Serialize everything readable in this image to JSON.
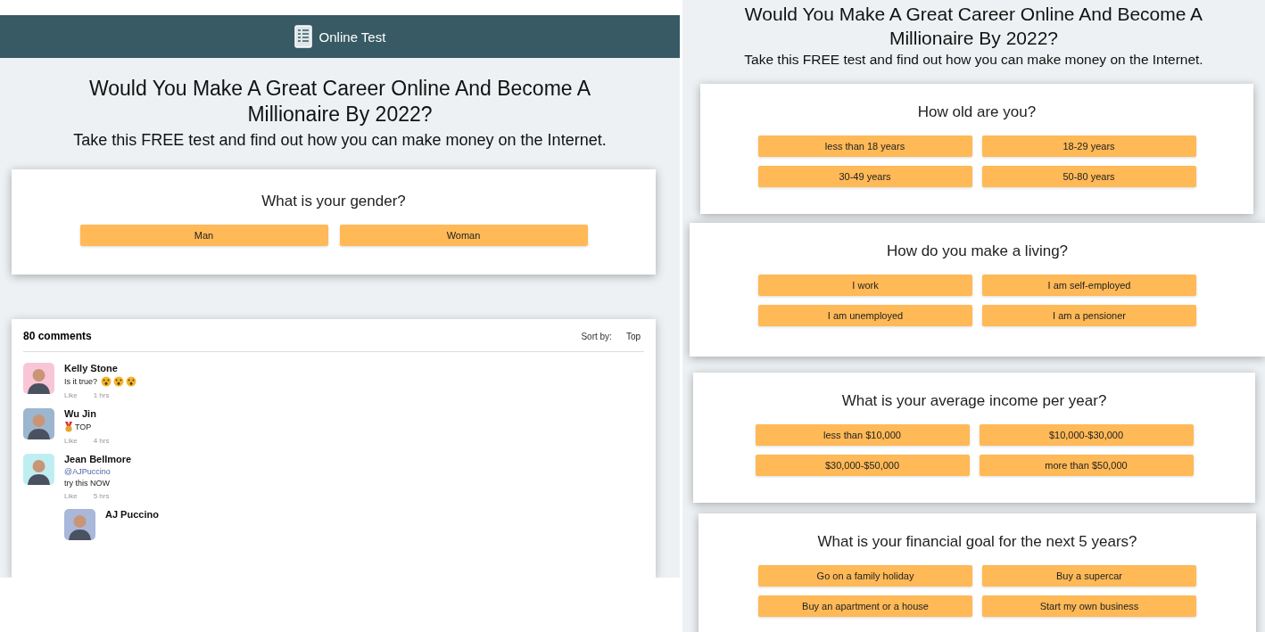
{
  "panels": [
    {
      "header": {
        "title": "Online Test"
      },
      "headline": "Would You Make A Great Career Online And Become A Millionaire By 2022?",
      "subline": "Take this FREE test and find out how you can make money on the Internet.",
      "questions": [
        {
          "question": "What is your gender?",
          "options": [
            "Man",
            "Woman"
          ]
        }
      ],
      "comments": {
        "count": "80 comments",
        "sort_label": "Sort by:",
        "sort_value": "Top",
        "items": [
          {
            "kind": "reaction",
            "name": "Kelly Stone",
            "text": "Is it true?",
            "like": "Like",
            "time": "1 hrs"
          },
          {
            "kind": "badge",
            "name": "Wu Jin",
            "text": "TOP",
            "like": "Like",
            "time": "4 hrs"
          },
          {
            "kind": "mention",
            "name": "Jean Bellmore",
            "mention": "@AJPuccino",
            "text": "try this NOW",
            "like": "Like",
            "time": "5 hrs"
          },
          {
            "kind": "reply",
            "name": "AJ Puccino"
          }
        ]
      }
    },
    {
      "headline": "Would You Make A Great Career Online And Become A Millionaire By 2022?",
      "subline": "Take this FREE test and find out how you can make money on the Internet.",
      "questions": [
        {
          "question": "How old are you?",
          "options": [
            "less than 18 years",
            "18-29 years",
            "30-49 years",
            "50-80 years"
          ]
        },
        {
          "question": "How do you make a living?",
          "options": [
            "I work",
            "I am self-employed",
            "I am unemployed",
            "I am a pensioner"
          ]
        },
        {
          "question": "What is your average income per year?",
          "options": [
            "less than $10,000",
            "$10,000-$30,000",
            "$30,000-$50,000",
            "more than $50,000"
          ]
        },
        {
          "question": "What is your financial goal for the next 5 years?",
          "options": [
            "Go on a family holiday",
            "Buy a supercar",
            "Buy an apartment or a house",
            "Start my own business"
          ]
        }
      ]
    }
  ]
}
